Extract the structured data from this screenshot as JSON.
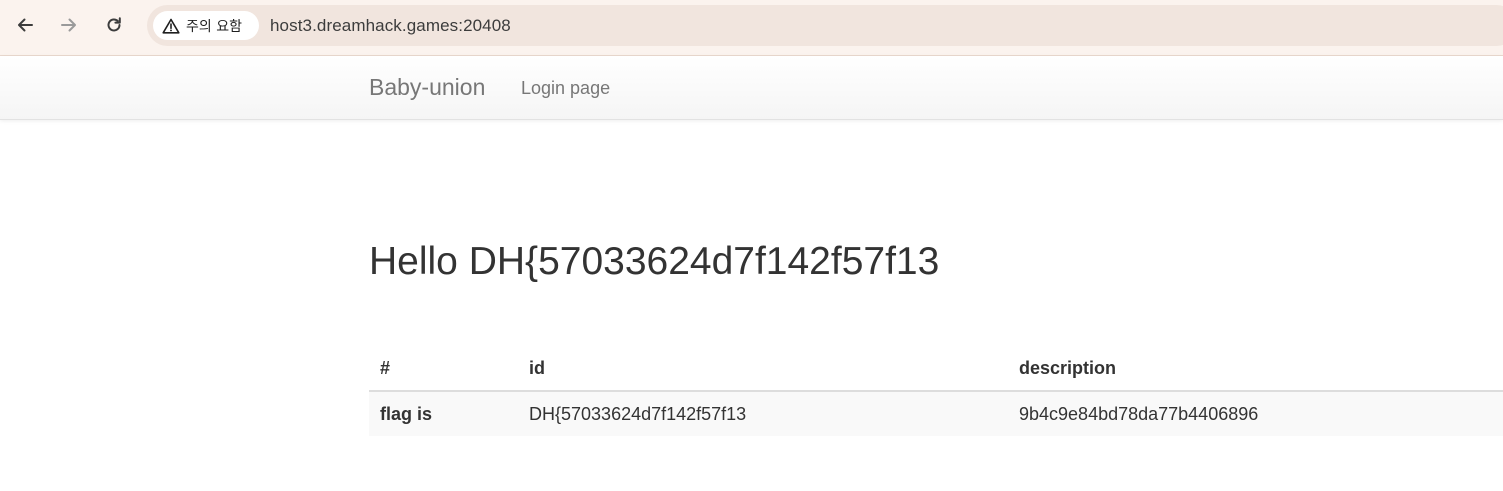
{
  "browser": {
    "security_label": "주의 요함",
    "url": "host3.dreamhack.games:20408",
    "icons": {
      "back": "arrow-left-icon",
      "forward": "arrow-right-icon",
      "reload": "reload-icon",
      "warning": "warning-triangle-icon"
    }
  },
  "navbar": {
    "brand": "Baby-union",
    "links": [
      "Login page"
    ]
  },
  "main": {
    "heading": "Hello DH{57033624d7f142f57f13",
    "table": {
      "columns": [
        "#",
        "id",
        "description"
      ],
      "rows": [
        [
          "flag is",
          "DH{57033624d7f142f57f13",
          "9b4c9e84bd78da77b4406896"
        ]
      ]
    }
  },
  "colors": {
    "browser_bar": "#fbf3ee",
    "omnibox": "#f1e5de",
    "navbar_text": "#777777",
    "body_text": "#333333",
    "row_stripe": "#f9f9f9"
  }
}
